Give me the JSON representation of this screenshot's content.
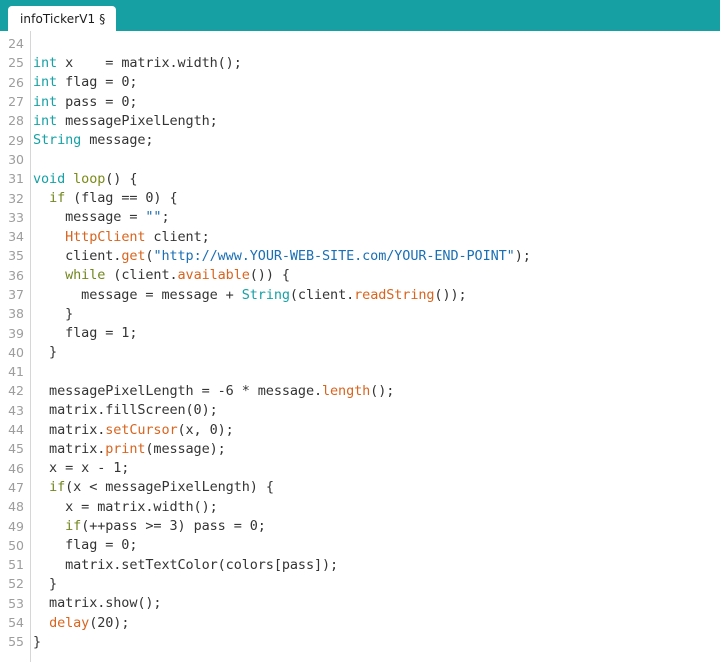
{
  "window": {
    "title": "infoTickerV1",
    "accent_color": "#17a0a3",
    "background_color": "#ffffff"
  },
  "tab_bar": {
    "background": "#17a0a3",
    "tabs": [
      {
        "label": "infoTickerV1",
        "modified_mark": "§",
        "active": true
      }
    ]
  },
  "editor": {
    "gutter_color": "#9d9d9d",
    "rule_color": "#d6d6d6",
    "first_line_number": 24,
    "last_line_number": 55,
    "token_colors": {
      "plain": "#343434",
      "type": "#15a1a5",
      "keyword": "#72861e",
      "function": "#d9641e",
      "user_function": "#7a8b16",
      "string": "#1a6fb5"
    },
    "lines": [
      {
        "n": 24,
        "tokens": []
      },
      {
        "n": 25,
        "tokens": [
          {
            "t": "int",
            "c": "type"
          },
          {
            "t": " x    = matrix.width();",
            "c": "plain"
          }
        ]
      },
      {
        "n": 26,
        "tokens": [
          {
            "t": "int",
            "c": "type"
          },
          {
            "t": " flag = 0;",
            "c": "plain"
          }
        ]
      },
      {
        "n": 27,
        "tokens": [
          {
            "t": "int",
            "c": "type"
          },
          {
            "t": " pass = 0;",
            "c": "plain"
          }
        ]
      },
      {
        "n": 28,
        "tokens": [
          {
            "t": "int",
            "c": "type"
          },
          {
            "t": " messagePixelLength;",
            "c": "plain"
          }
        ]
      },
      {
        "n": 29,
        "tokens": [
          {
            "t": "String",
            "c": "type"
          },
          {
            "t": " message;",
            "c": "plain"
          }
        ]
      },
      {
        "n": 30,
        "tokens": []
      },
      {
        "n": 31,
        "tokens": [
          {
            "t": "void",
            "c": "type"
          },
          {
            "t": " ",
            "c": "plain"
          },
          {
            "t": "loop",
            "c": "user_function"
          },
          {
            "t": "() {",
            "c": "plain"
          }
        ]
      },
      {
        "n": 32,
        "tokens": [
          {
            "t": "  ",
            "c": "plain"
          },
          {
            "t": "if",
            "c": "keyword"
          },
          {
            "t": " (flag == 0) {",
            "c": "plain"
          }
        ]
      },
      {
        "n": 33,
        "tokens": [
          {
            "t": "    message = ",
            "c": "plain"
          },
          {
            "t": "\"\"",
            "c": "string"
          },
          {
            "t": ";",
            "c": "plain"
          }
        ]
      },
      {
        "n": 34,
        "tokens": [
          {
            "t": "    ",
            "c": "plain"
          },
          {
            "t": "HttpClient",
            "c": "function"
          },
          {
            "t": " client;",
            "c": "plain"
          }
        ]
      },
      {
        "n": 35,
        "tokens": [
          {
            "t": "    client.",
            "c": "plain"
          },
          {
            "t": "get",
            "c": "function"
          },
          {
            "t": "(",
            "c": "plain"
          },
          {
            "t": "\"http://www.YOUR-WEB-SITE.com/YOUR-END-POINT\"",
            "c": "string"
          },
          {
            "t": ");",
            "c": "plain"
          }
        ]
      },
      {
        "n": 36,
        "tokens": [
          {
            "t": "    ",
            "c": "plain"
          },
          {
            "t": "while",
            "c": "keyword"
          },
          {
            "t": " (client.",
            "c": "plain"
          },
          {
            "t": "available",
            "c": "function"
          },
          {
            "t": "()) {",
            "c": "plain"
          }
        ]
      },
      {
        "n": 37,
        "tokens": [
          {
            "t": "      message = message + ",
            "c": "plain"
          },
          {
            "t": "String",
            "c": "type"
          },
          {
            "t": "(client.",
            "c": "plain"
          },
          {
            "t": "readString",
            "c": "function"
          },
          {
            "t": "());",
            "c": "plain"
          }
        ]
      },
      {
        "n": 38,
        "tokens": [
          {
            "t": "    }",
            "c": "plain"
          }
        ]
      },
      {
        "n": 39,
        "tokens": [
          {
            "t": "    flag = 1;",
            "c": "plain"
          }
        ]
      },
      {
        "n": 40,
        "tokens": [
          {
            "t": "  }",
            "c": "plain"
          }
        ]
      },
      {
        "n": 41,
        "tokens": []
      },
      {
        "n": 42,
        "tokens": [
          {
            "t": "  messagePixelLength = -6 * message.",
            "c": "plain"
          },
          {
            "t": "length",
            "c": "function"
          },
          {
            "t": "();",
            "c": "plain"
          }
        ]
      },
      {
        "n": 43,
        "tokens": [
          {
            "t": "  matrix.fillScreen(0);",
            "c": "plain"
          }
        ]
      },
      {
        "n": 44,
        "tokens": [
          {
            "t": "  matrix.",
            "c": "plain"
          },
          {
            "t": "setCursor",
            "c": "function"
          },
          {
            "t": "(x, 0);",
            "c": "plain"
          }
        ]
      },
      {
        "n": 45,
        "tokens": [
          {
            "t": "  matrix.",
            "c": "plain"
          },
          {
            "t": "print",
            "c": "function"
          },
          {
            "t": "(message);",
            "c": "plain"
          }
        ]
      },
      {
        "n": 46,
        "tokens": [
          {
            "t": "  x = x - 1;",
            "c": "plain"
          }
        ]
      },
      {
        "n": 47,
        "tokens": [
          {
            "t": "  ",
            "c": "plain"
          },
          {
            "t": "if",
            "c": "keyword"
          },
          {
            "t": "(x < messagePixelLength) {",
            "c": "plain"
          }
        ]
      },
      {
        "n": 48,
        "tokens": [
          {
            "t": "    x = matrix.width();",
            "c": "plain"
          }
        ]
      },
      {
        "n": 49,
        "tokens": [
          {
            "t": "    ",
            "c": "plain"
          },
          {
            "t": "if",
            "c": "keyword"
          },
          {
            "t": "(++pass >= 3) pass = 0;",
            "c": "plain"
          }
        ]
      },
      {
        "n": 50,
        "tokens": [
          {
            "t": "    flag = 0;",
            "c": "plain"
          }
        ]
      },
      {
        "n": 51,
        "tokens": [
          {
            "t": "    matrix.setTextColor(colors[pass]);",
            "c": "plain"
          }
        ]
      },
      {
        "n": 52,
        "tokens": [
          {
            "t": "  }",
            "c": "plain"
          }
        ]
      },
      {
        "n": 53,
        "tokens": [
          {
            "t": "  matrix.show();",
            "c": "plain"
          }
        ]
      },
      {
        "n": 54,
        "tokens": [
          {
            "t": "  ",
            "c": "plain"
          },
          {
            "t": "delay",
            "c": "function"
          },
          {
            "t": "(20);",
            "c": "plain"
          }
        ]
      },
      {
        "n": 55,
        "tokens": [
          {
            "t": "}",
            "c": "plain"
          }
        ]
      }
    ]
  }
}
